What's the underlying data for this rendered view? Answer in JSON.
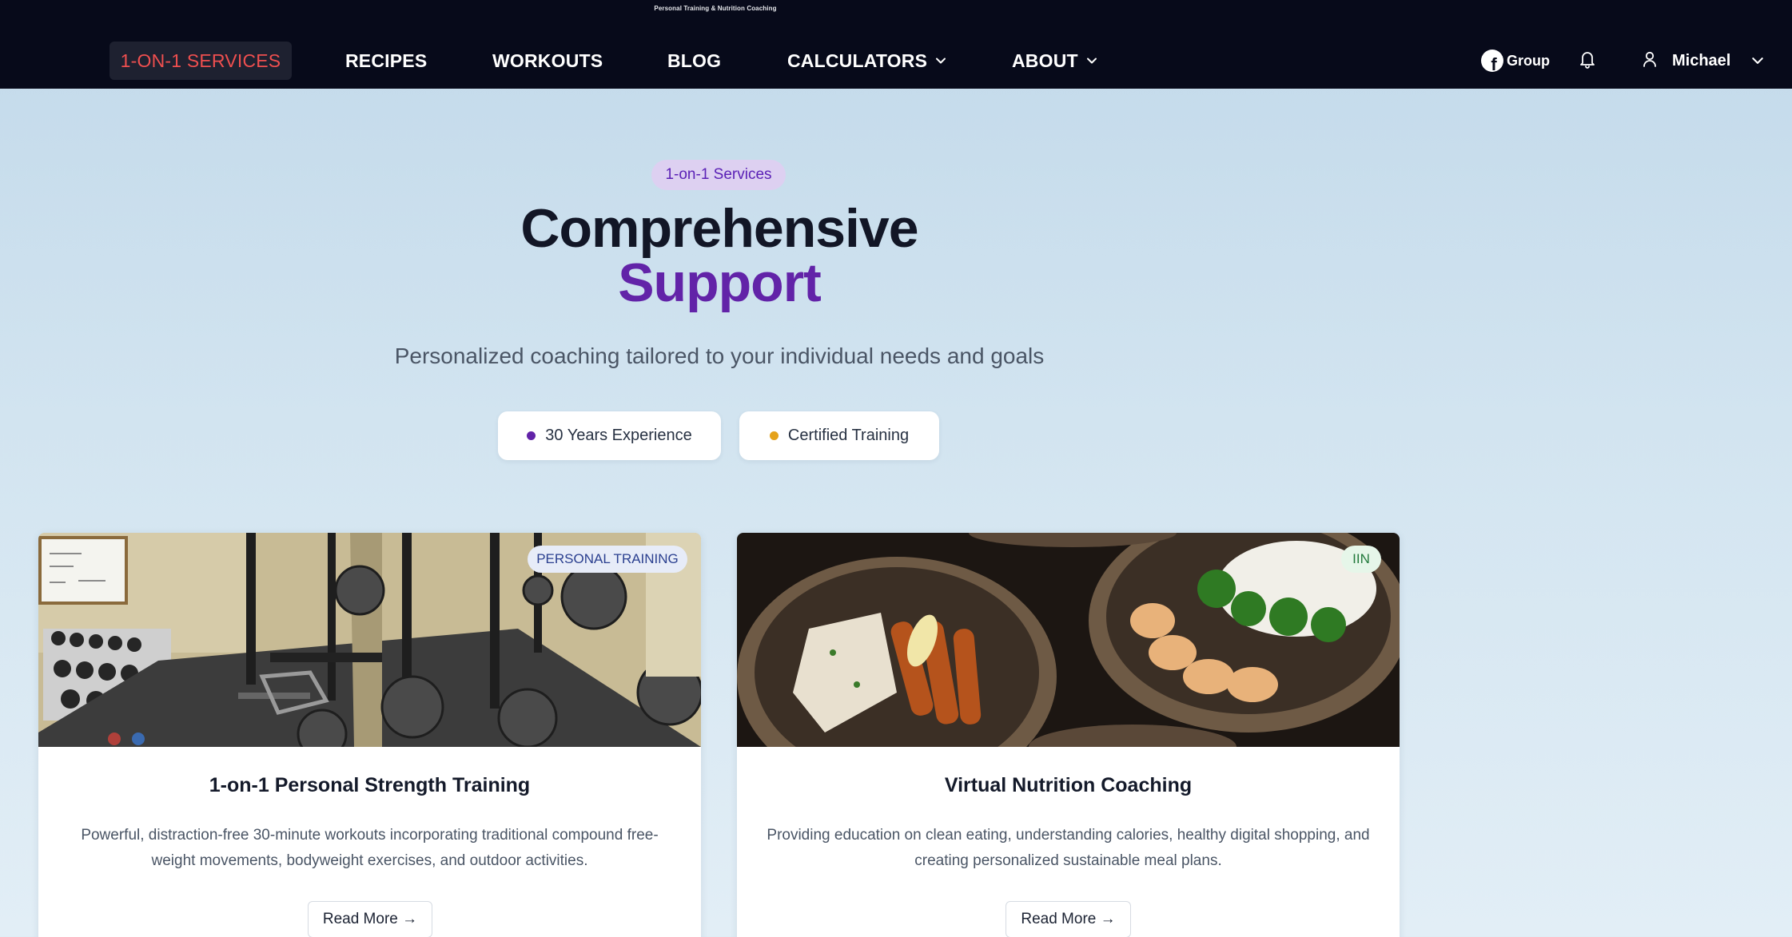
{
  "header": {
    "tagline": "Personal Training & Nutrition Coaching",
    "nav": [
      {
        "label": "1-ON-1 SERVICES",
        "active": true
      },
      {
        "label": "RECIPES"
      },
      {
        "label": "WORKOUTS"
      },
      {
        "label": "BLOG"
      },
      {
        "label": "CALCULATORS",
        "has_dropdown": true
      },
      {
        "label": "ABOUT",
        "has_dropdown": true
      }
    ],
    "group_label": "Group",
    "group_icon": "facebook-icon",
    "notifications_icon": "bell-icon",
    "user": {
      "name": "Michael",
      "icon": "user-icon"
    }
  },
  "hero": {
    "pill": "1-on-1 Services",
    "title_line1": "Comprehensive",
    "title_line2": "Support",
    "subtitle": "Personalized coaching tailored to your individual needs and goals",
    "badges": [
      {
        "label": "30 Years Experience",
        "dot_color": "#6223a8"
      },
      {
        "label": "Certified Training",
        "dot_color": "#e5a21a"
      }
    ]
  },
  "cards": [
    {
      "tag": "PERSONAL TRAINING",
      "title": "1-on-1 Personal Strength Training",
      "description": "Powerful, distraction-free 30-minute workouts incorporating traditional compound free-weight movements, bodyweight exercises, and outdoor activities.",
      "button": "Read More →"
    },
    {
      "tag": "IIN",
      "title": "Virtual Nutrition Coaching",
      "description": "Providing education on clean eating, understanding calories, healthy digital shopping, and creating personalized sustainable meal plans.",
      "button": "Read More →"
    }
  ],
  "colors": {
    "nav_bg": "#070a1a",
    "active_nav_text": "#ef4f4f",
    "accent_purple": "#6223a8",
    "page_bg": "#c8dded"
  }
}
